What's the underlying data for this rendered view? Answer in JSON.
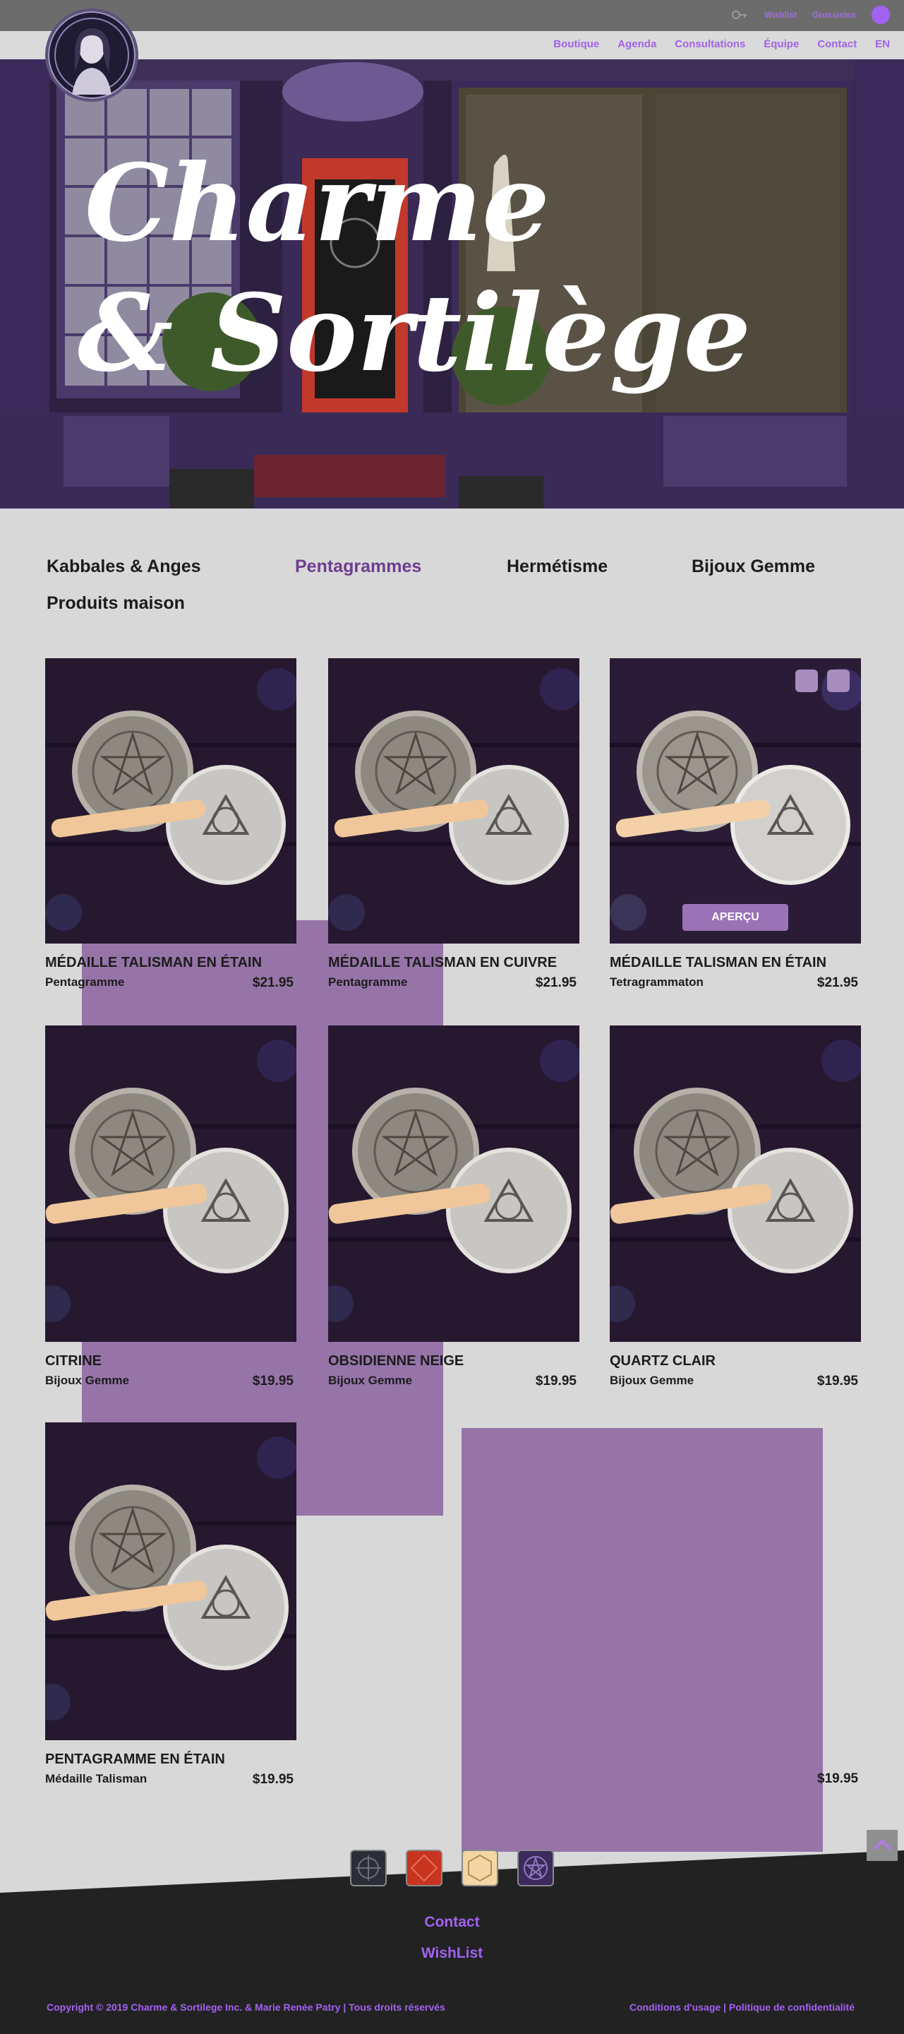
{
  "header": {
    "wishlist": "Wishlist",
    "grossistes": "Grossistes",
    "menu": [
      "Boutique",
      "Agenda",
      "Consultations",
      "Équipe",
      "Contact",
      "EN"
    ]
  },
  "hero": {
    "title_line1": "Charme",
    "title_line2": "& Sortilège"
  },
  "categories": [
    {
      "label": "Kabbales & Anges",
      "active": false
    },
    {
      "label": "Pentagrammes",
      "active": true
    },
    {
      "label": "Hermétisme",
      "active": false
    },
    {
      "label": "Bijoux Gemme",
      "active": false
    },
    {
      "label": "Produits maison",
      "active": false
    }
  ],
  "products": [
    {
      "title": "Médaille Talisman en Étain",
      "subtitle": "Pentagramme",
      "price": "$21.95"
    },
    {
      "title": "Médaille Talisman en Cuivre",
      "subtitle": "Pentagramme",
      "price": "$21.95"
    },
    {
      "title": "Médaille Talisman en Étain",
      "subtitle": "Tetragrammaton",
      "price": "$21.95",
      "button": "APERÇU"
    },
    {
      "title": "Citrine",
      "subtitle": "Bijoux Gemme",
      "price": "$19.95"
    },
    {
      "title": "Obsidienne Neige",
      "subtitle": "Bijoux Gemme",
      "price": "$19.95"
    },
    {
      "title": "Quartz Clair",
      "subtitle": "Bijoux Gemme",
      "price": "$19.95"
    },
    {
      "title": "Pentagramme en Étain",
      "subtitle": "Médaille Talisman",
      "price": "$19.95"
    }
  ],
  "extra_price": "$19.95",
  "footer": {
    "contact": "Contact",
    "wishlist": "WishList",
    "copyright": "Copyright © 2019 Charme & Sortilege Inc. & Marie Renée Patry | Tous droits réservés",
    "legal": "Conditions d'usage | Politique de confidentialité"
  },
  "colors": {
    "accent": "#a162f2",
    "deco": "#9674a8",
    "footer": "#222222"
  }
}
